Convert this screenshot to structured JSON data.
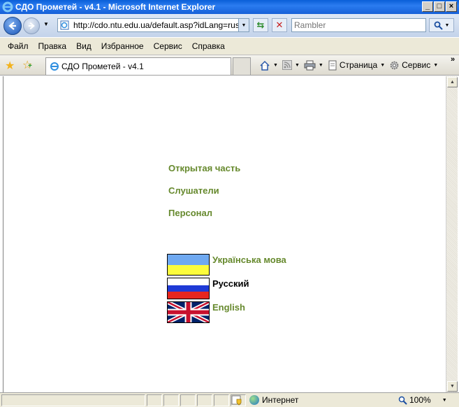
{
  "window": {
    "title": "СДО Прометей - v4.1 - Microsoft Internet Explorer",
    "controls": [
      "_",
      "□",
      "×"
    ]
  },
  "address_bar": {
    "url": "http://cdo.ntu.edu.ua/default.asp?idLang=rus",
    "search_placeholder": "Rambler"
  },
  "menu": [
    "Файл",
    "Правка",
    "Вид",
    "Избранное",
    "Сервис",
    "Справка"
  ],
  "tab": {
    "title": "СДО Прометей - v4.1"
  },
  "toolbar": {
    "page_label": "Страница",
    "tools_label": "Сервис",
    "more": "»"
  },
  "page": {
    "links": [
      "Открытая часть",
      "Слушатели",
      "Персонал"
    ],
    "languages": [
      {
        "label": "Українська мова",
        "flag": "ukraine-flag",
        "active": false
      },
      {
        "label": "Русский",
        "flag": "russia-flag",
        "active": true
      },
      {
        "label": "English",
        "flag": "uk-flag",
        "active": false
      }
    ],
    "link_color": "#66892d"
  },
  "status_bar": {
    "zone": "Интернет",
    "zoom": "100%"
  }
}
